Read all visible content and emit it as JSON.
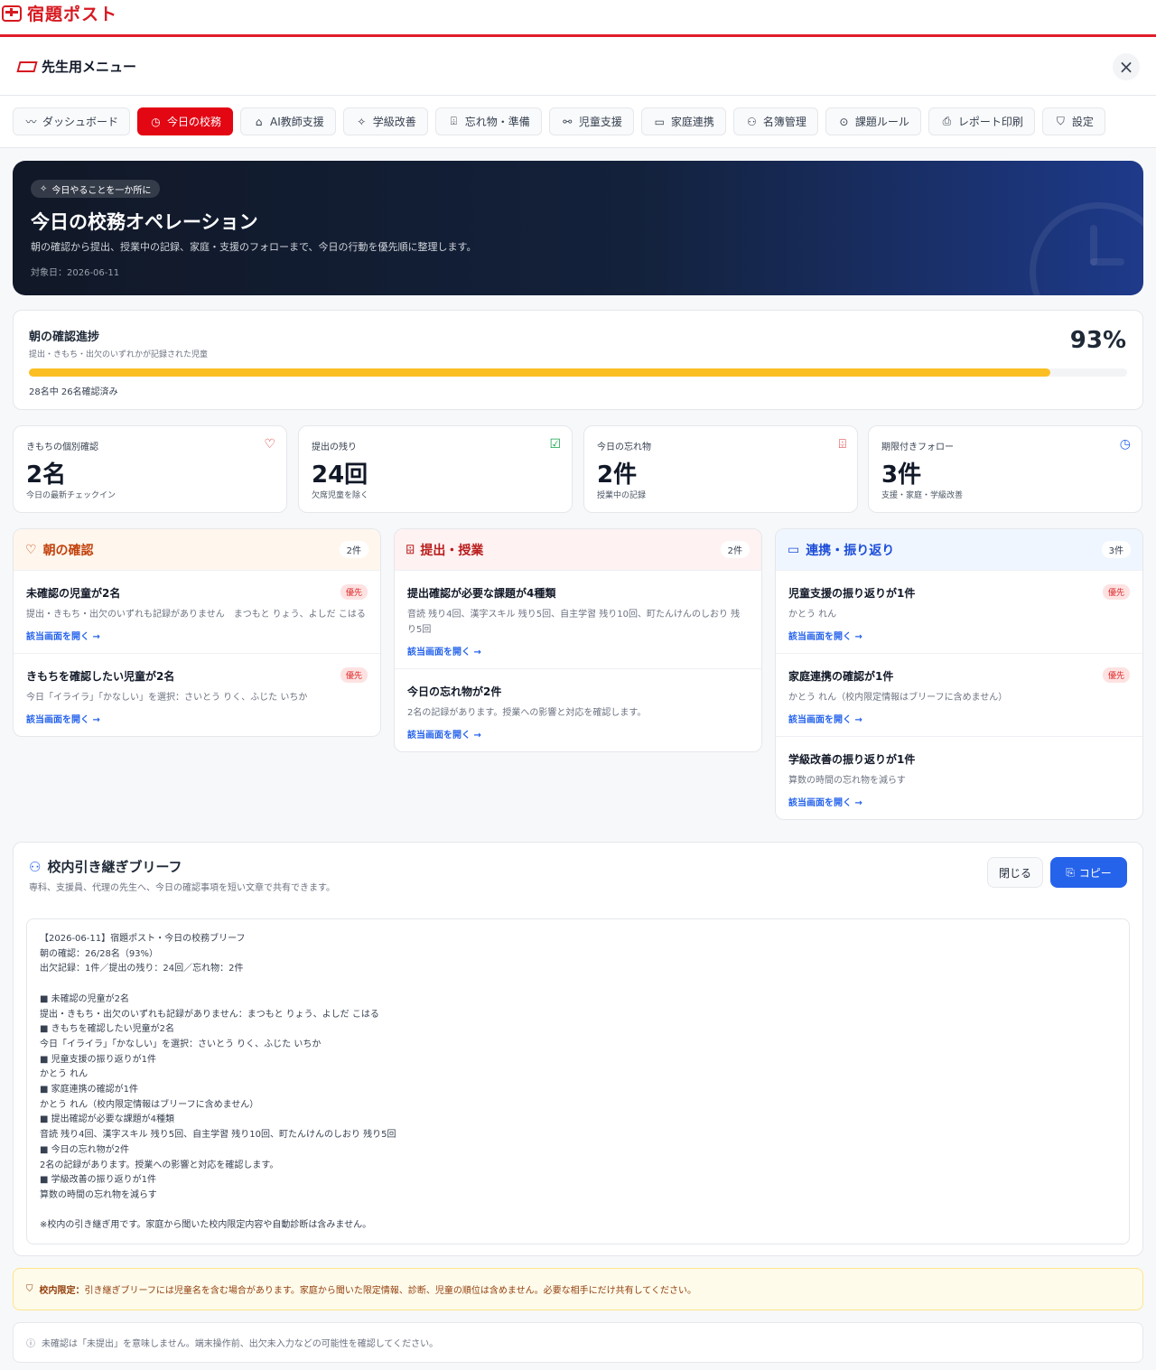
{
  "app": {
    "name": "宿題ポスト"
  },
  "menu": {
    "title": "先生用メニュー",
    "close": "×"
  },
  "tabs": [
    {
      "label": "ダッシュボード",
      "icon": "〰"
    },
    {
      "label": "今日の校務",
      "icon": "◷"
    },
    {
      "label": "AI教師支援",
      "icon": "⌂"
    },
    {
      "label": "学級改善",
      "icon": "✧"
    },
    {
      "label": "忘れ物・準備",
      "icon": "⌹"
    },
    {
      "label": "児童支援",
      "icon": "⚯"
    },
    {
      "label": "家庭連携",
      "icon": "▭"
    },
    {
      "label": "名簿管理",
      "icon": "⚇"
    },
    {
      "label": "課題ルール",
      "icon": "⊙"
    },
    {
      "label": "レポート印刷",
      "icon": "⎙"
    },
    {
      "label": "設定",
      "icon": "⛉"
    }
  ],
  "hero": {
    "badge": "今日やることを一か所に",
    "title": "今日の校務オペレーション",
    "description": "朝の確認から提出、授業中の記録、家庭・支援のフォローまで、今日の行動を優先順に整理します。",
    "date": "対象日：2026-06-11"
  },
  "progress": {
    "title": "朝の確認進捗",
    "subtitle": "提出・きもち・出欠のいずれかが記録された児童",
    "percent_label": "93%",
    "value": 0.93,
    "note": "28名中 26名確認済み",
    "color": "#fbbf24"
  },
  "stats": [
    {
      "label": "きもちの個別確認",
      "value": "2名",
      "sub": "今日の最新チェックイン",
      "icon": "♡",
      "color": "#dc2626"
    },
    {
      "label": "提出の残り",
      "value": "24回",
      "sub": "欠席児童を除く",
      "icon": "☑",
      "color": "#16a34a"
    },
    {
      "label": "今日の忘れ物",
      "value": "2件",
      "sub": "授業中の記録",
      "icon": "⌹",
      "color": "#dc2626"
    },
    {
      "label": "期限付きフォロー",
      "value": "3件",
      "sub": "支援・家庭・学級改善",
      "icon": "◷",
      "color": "#2563eb"
    }
  ],
  "panels": [
    {
      "title": "朝の確認",
      "count": "2件",
      "icon": "♡",
      "color": "#c2410c",
      "bg": "#fff7ed",
      "items": [
        {
          "title": "未確認の児童が2名",
          "badge": "優先",
          "desc": "提出・きもち・出欠のいずれも記録がありません　まつもと りょう、よしだ こはる",
          "link": "該当画面を開く →"
        },
        {
          "title": "きもちを確認したい児童が2名",
          "badge": "優先",
          "desc": "今日「イライラ」「かなしい」を選択：さいとう りく、ふじた いちか",
          "link": "該当画面を開く →"
        }
      ]
    },
    {
      "title": "提出・授業",
      "count": "2件",
      "icon": "⌹",
      "color": "#b91c1c",
      "bg": "#fef2f2",
      "items": [
        {
          "title": "提出確認が必要な課題が4種類",
          "badge": "",
          "desc": "音読 残り4回、漢字スキル 残り5回、自主学習 残り10回、町たんけんのしおり 残り5回",
          "link": "該当画面を開く →"
        },
        {
          "title": "今日の忘れ物が2件",
          "badge": "",
          "desc": "2名の記録があります。授業への影響と対応を確認します。",
          "link": "該当画面を開く →"
        }
      ]
    },
    {
      "title": "連携・振り返り",
      "count": "3件",
      "icon": "▭",
      "color": "#1d4ed8",
      "bg": "#eff6ff",
      "items": [
        {
          "title": "児童支援の振り返りが1件",
          "badge": "優先",
          "desc": "かとう れん",
          "link": "該当画面を開く →"
        },
        {
          "title": "家庭連携の確認が1件",
          "badge": "優先",
          "desc": "かとう れん（校内限定情報はブリーフに含めません）",
          "link": "該当画面を開く →"
        },
        {
          "title": "学級改善の振り返りが1件",
          "badge": "",
          "desc": "算数の時間の忘れ物を減らす",
          "link": "該当画面を開く →"
        }
      ]
    }
  ],
  "brief": {
    "title": "校内引き継ぎブリーフ",
    "subtitle": "専科、支援員、代理の先生へ、今日の確認事項を短い文章で共有できます。",
    "close_label": "閉じる",
    "copy_label": "コピー",
    "text": "【2026-06-11】宿題ポスト・今日の校務ブリーフ\n朝の確認：26/28名（93%）\n出欠記録：1件／提出の残り：24回／忘れ物：2件\n\n■ 未確認の児童が2名\n提出・きもち・出欠のいずれも記録がありません：まつもと りょう、よしだ こはる\n■ きもちを確認したい児童が2名\n今日「イライラ」「かなしい」を選択：さいとう りく、ふじた いちか\n■ 児童支援の振り返りが1件\nかとう れん\n■ 家庭連携の確認が1件\nかとう れん（校内限定情報はブリーフに含めません）\n■ 提出確認が必要な課題が4種類\n音読 残り4回、漢字スキル 残り5回、自主学習 残り10回、町たんけんのしおり 残り5回\n■ 今日の忘れ物が2件\n2名の記録があります。授業への影響と対応を確認します。\n■ 学級改善の振り返りが1件\n算数の時間の忘れ物を減らす\n\n※校内の引き継ぎ用です。家庭から聞いた校内限定内容や自動診断は含みません。"
  },
  "notice": {
    "label": "校内限定：",
    "text": "引き継ぎブリーフには児童名を含む場合があります。家庭から聞いた限定情報、診断、児童の順位は含めません。必要な相手にだけ共有してください。"
  },
  "footer": {
    "text": "未確認は「未提出」を意味しません。端末操作前、出欠未入力などの可能性を確認してください。"
  }
}
